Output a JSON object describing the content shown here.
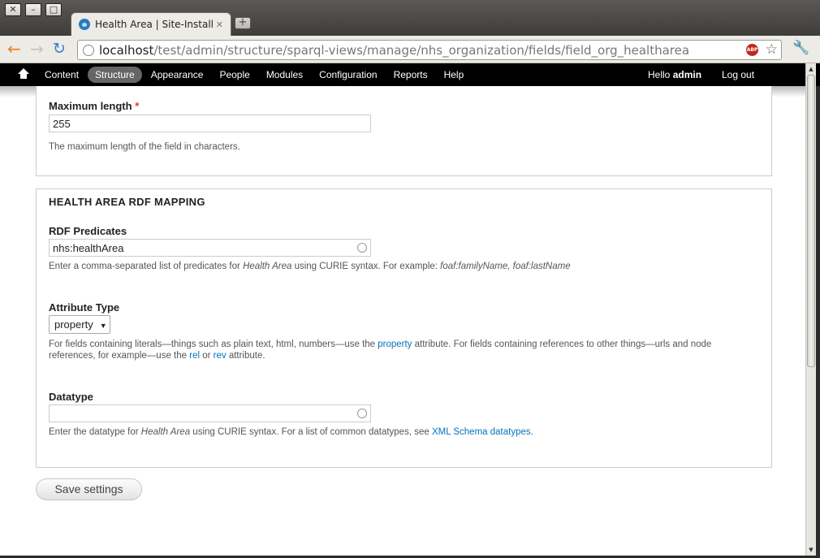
{
  "window": {
    "minimize": "–",
    "maximize": "□",
    "close": "✕"
  },
  "tab": {
    "title": "Health Area | Site-Install",
    "close": "✕",
    "new_tab": "+"
  },
  "browser": {
    "url_host": "localhost",
    "url_path": "/test/admin/structure/sparql-views/manage/nhs_organization/fields/field_org_healtharea",
    "abp_label": "ABP"
  },
  "admin_menu": {
    "items": [
      "Content",
      "Structure",
      "Appearance",
      "People",
      "Modules",
      "Configuration",
      "Reports",
      "Help"
    ],
    "active": "Structure",
    "hello": "Hello",
    "username": "admin",
    "logout": "Log out"
  },
  "form": {
    "max_length": {
      "label": "Maximum length",
      "required_marker": "*",
      "value": "255",
      "description": "The maximum length of the field in characters."
    },
    "rdf_section": {
      "legend": "HEALTH AREA RDF MAPPING",
      "predicates": {
        "label": "RDF Predicates",
        "value": "nhs:healthArea",
        "desc_prefix": "Enter a comma-separated list of predicates for ",
        "desc_field": "Health Area",
        "desc_middle": " using CURIE syntax. For example: ",
        "desc_example": "foaf:familyName, foaf:lastName"
      },
      "attribute_type": {
        "label": "Attribute Type",
        "selected": "property",
        "desc_1": "For fields containing literals—things such as plain text, html, numbers—use the ",
        "desc_link_property": "property",
        "desc_2": " attribute. For fields containing references to other things—urls and node",
        "desc_3": "references, for example—use the ",
        "desc_link_rel": "rel",
        "desc_or": " or ",
        "desc_link_rev": "rev",
        "desc_4": " attribute."
      },
      "datatype": {
        "label": "Datatype",
        "value": "",
        "desc_prefix": "Enter the datatype for ",
        "desc_field": "Health Area",
        "desc_middle": " using CURIE syntax. For a list of common datatypes, see ",
        "desc_link": "XML Schema datatypes",
        "desc_suffix": "."
      }
    },
    "save_button": "Save settings"
  }
}
